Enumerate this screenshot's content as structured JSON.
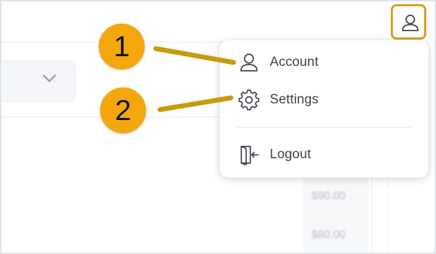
{
  "colors": {
    "accent": "#f4a70d",
    "highlight_border": "#d49f1e",
    "text": "#3b4048"
  },
  "header": {
    "user_button_icon": "user-icon"
  },
  "filter": {
    "dropdown_icon": "chevron-down-icon"
  },
  "table": {
    "amounts": [
      "$90.00",
      "$80.00"
    ]
  },
  "user_menu": {
    "items": [
      {
        "label": "Account",
        "icon": "user-icon"
      },
      {
        "label": "Settings",
        "icon": "gear-icon"
      },
      {
        "label": "Logout",
        "icon": "logout-icon"
      }
    ]
  },
  "callouts": {
    "badges": [
      "1",
      "2"
    ]
  }
}
